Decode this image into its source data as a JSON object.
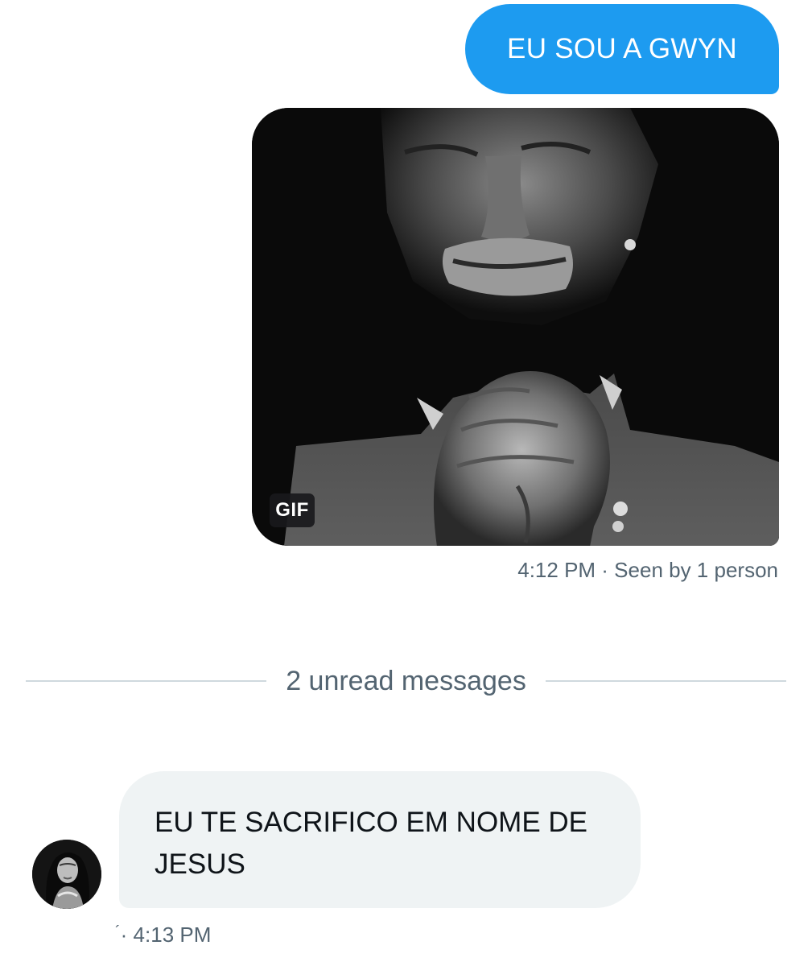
{
  "conversation": {
    "sent_message": {
      "text": "EU SOU A GWYN"
    },
    "sent_gif": {
      "badge": "GIF",
      "meta": "4:12 PM · Seen by 1 person"
    },
    "unread_divider": {
      "label": "2 unread messages"
    },
    "received_message": {
      "line1": "EU TE SACRIFICO EM NOME DE",
      "line2": "JESUS",
      "sender_mark": "´",
      "meta": "· 4:13 PM"
    }
  },
  "colors": {
    "sent_bubble": "#1d9bf0",
    "received_bubble": "#eff3f4",
    "meta_text": "#536471",
    "divider_line": "#cfd9de"
  },
  "icons": {
    "avatar": "user-avatar-photo",
    "gif": "gif-image"
  }
}
